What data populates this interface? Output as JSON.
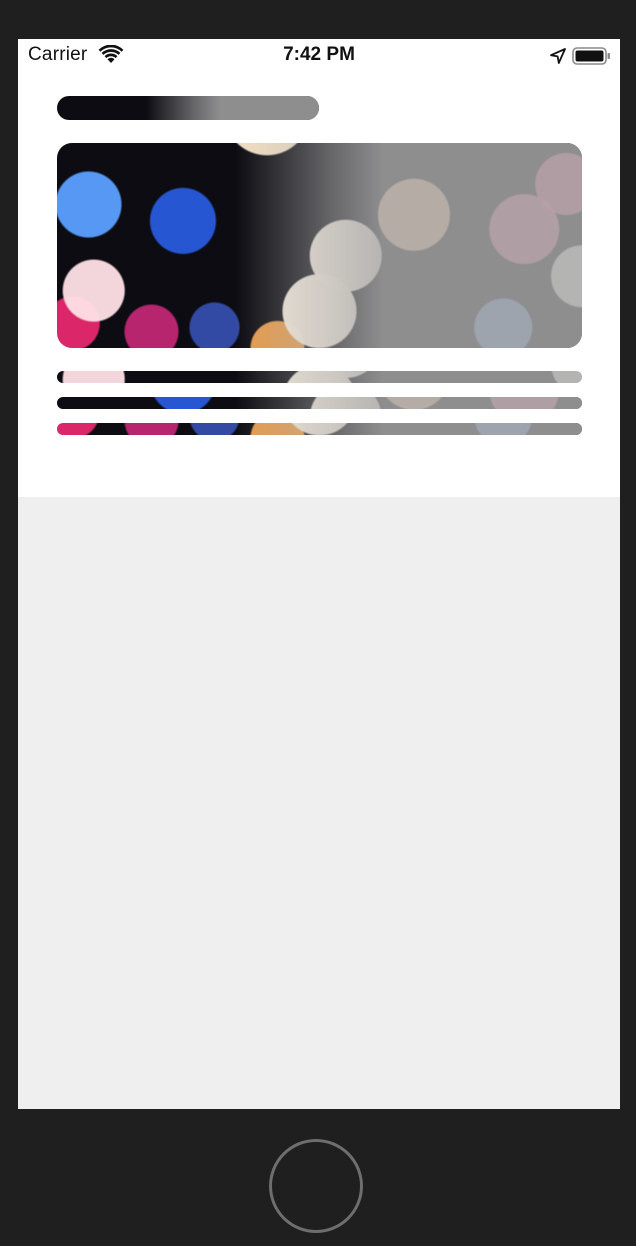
{
  "status_bar": {
    "carrier": "Carrier",
    "time": "7:42 PM",
    "wifi_icon": "wifi-icon",
    "location_icon": "location-arrow-icon",
    "battery_icon": "battery-icon"
  },
  "skeleton": {
    "elements": [
      "title-placeholder",
      "hero-image-placeholder",
      "text-line-placeholder",
      "text-line-placeholder",
      "text-line-placeholder"
    ]
  },
  "device": {
    "home_button_icon": "home-button-ring"
  },
  "colors": {
    "screen_background": "#efefef",
    "content_background": "#ffffff",
    "device_frame": "#1f1f1f"
  }
}
